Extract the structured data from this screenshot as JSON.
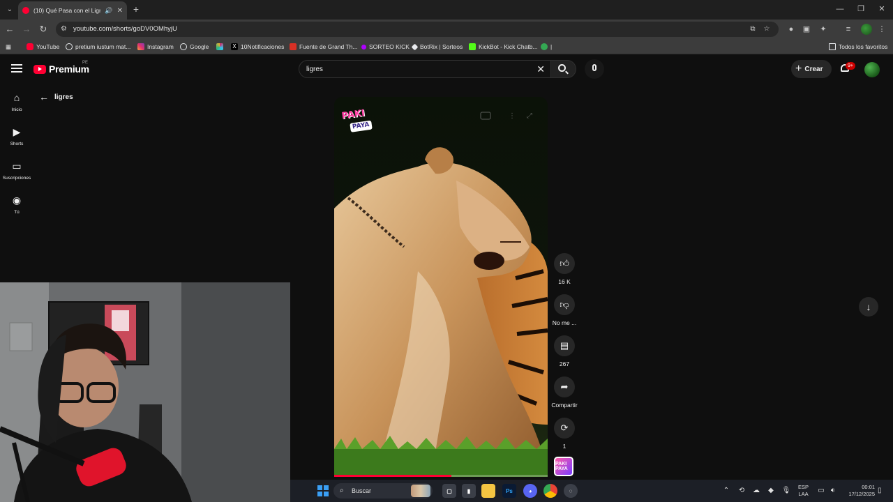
{
  "browser": {
    "tab_title": "(10) Qué Pasa con el Ligre ",
    "url": "youtube.com/shorts/goDV0OMhyjU",
    "bookmarks": [
      {
        "label": "YouTube",
        "color": "#ff0033"
      },
      {
        "label": "pretium iustum mat...",
        "color": "#e8eaed"
      },
      {
        "label": "Instagram",
        "color": "#e1306c"
      },
      {
        "label": "Google",
        "color": "#e8eaed"
      },
      {
        "label": "",
        "color": "#8ab4f8"
      },
      {
        "label": "10Notificaciones",
        "color": "#000000"
      },
      {
        "label": "Fuente de Grand Th...",
        "color": "#d93025"
      },
      {
        "label": "SORTEO KICK",
        "color": "#b000ff"
      },
      {
        "label": "BotRix | Sorteos",
        "color": "#e8eaed"
      },
      {
        "label": "KickBot - Kick Chatb...",
        "color": "#53fc18"
      },
      {
        "label": "|",
        "color": "#34a853"
      }
    ],
    "all_bookmarks": "Todos los favoritos"
  },
  "youtube": {
    "brand": "Premium",
    "region": "PE",
    "search_query": "ligres",
    "create_label": "Crear",
    "notif_count": "9+",
    "back_label": "ligres",
    "guide": [
      {
        "label": "Inicio",
        "icon": "home-icon"
      },
      {
        "label": "Shorts",
        "icon": "shorts-icon"
      },
      {
        "label": "Suscripciones",
        "icon": "subscriptions-icon"
      },
      {
        "label": "Tú",
        "icon": "you-icon"
      }
    ],
    "short": {
      "channel_logo_top": "PAKI",
      "channel_logo_bottom": "PAYA",
      "progress": 0.55
    },
    "actions": {
      "like_count": "16 K",
      "dislike_label": "No me ...",
      "comments_count": "267",
      "share_label": "Compartir",
      "remix_count": "1"
    },
    "channel_thumb": "PAKI PAYA"
  },
  "taskbar": {
    "search_label": "Buscar",
    "lang_top": "ESP",
    "lang_bottom": "LAA",
    "time": "00:01",
    "date": "17/12/2025"
  },
  "colors": {
    "accent": "#ff0033",
    "background": "#0f0f0f"
  }
}
